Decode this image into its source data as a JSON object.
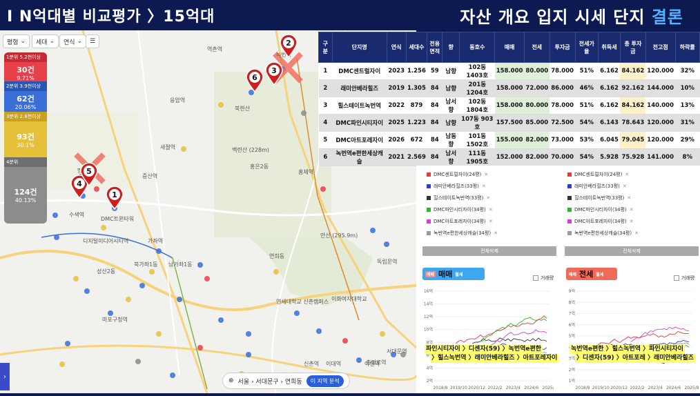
{
  "header": {
    "left": "I N억대별 비교평가 〉15억대",
    "right_main": "자산 개요 입지 시세 단지",
    "right_hl": "결론"
  },
  "map": {
    "controls": [
      "평형",
      "세대",
      "연식"
    ],
    "legend": [
      {
        "head": "1분위 5.2천이상",
        "value": "30건",
        "pct": "9.71%",
        "color": "#e8404a"
      },
      {
        "head": "2분위 3.9천이상",
        "value": "62건",
        "pct": "20.06%",
        "color": "#3a6fd8"
      },
      {
        "head": "3분위 2.8천이상",
        "value": "93건",
        "pct": "30.1%",
        "color": "#e7c03a"
      },
      {
        "head": "4분위",
        "value": "124건",
        "pct": "40.13%",
        "color": "#8c8c8c"
      }
    ],
    "labels": [
      "역촌역",
      "응암역",
      "새절역",
      "증산역",
      "수색역",
      "DMC트윈타워",
      "디지털미디어시티역",
      "가좌역",
      "홍제역",
      "홍은2동",
      "연희동",
      "신촌역",
      "이대역",
      "아현역",
      "마포구청역",
      "성산2동",
      "망원1동",
      "녹번역",
      "불광역",
      "북가좌1동",
      "남가좌1동",
      "연세대학교 신촌캠퍼스",
      "이화여자대학교",
      "안산 (295.9m)",
      "백련산 (228m)",
      "북한산",
      "독립문역",
      "충정로역",
      "서대문역"
    ],
    "location": "서울 › 서대문구 › 연희동",
    "analysis_btn": "이 지역 분석",
    "pins": [
      "1",
      "2",
      "3",
      "4",
      "5",
      "6"
    ]
  },
  "table": {
    "headers": [
      "구분",
      "단지명",
      "연식",
      "세대수",
      "전용면적",
      "향",
      "동호수",
      "매매",
      "전세",
      "투자금",
      "전세가율",
      "취득세",
      "총 투자금",
      "전고점",
      "하락률"
    ],
    "rows": [
      [
        "1",
        "DMC센트럴자이",
        "2023",
        "1.256",
        "59",
        "남향",
        "102동 1403호",
        "158.000",
        "80.000",
        "78.000",
        "51%",
        "6.162",
        "84.162",
        "120.000",
        "32%"
      ],
      [
        "2",
        "래미안베라힐즈",
        "2019",
        "1.305",
        "84",
        "남향",
        "201동 1204호",
        "158.000",
        "72.000",
        "86.000",
        "46%",
        "6.162",
        "92.162",
        "144.000",
        "10%"
      ],
      [
        "3",
        "힐스테이트녹번역",
        "2022",
        "879",
        "84",
        "남서향",
        "102동 1804호",
        "158.000",
        "80.000",
        "78.000",
        "51%",
        "6.162",
        "84.162",
        "140.000",
        "13%"
      ],
      [
        "4",
        "DMC파인시티자이",
        "2025",
        "1.223",
        "84",
        "남향",
        "107동 903호",
        "157.500",
        "85.000",
        "72.500",
        "54%",
        "6.143",
        "78.643",
        "120.000",
        "31%"
      ],
      [
        "5",
        "DMC아트포레자이",
        "2026",
        "672",
        "84",
        "남동향",
        "101동 1502호",
        "155.000",
        "82.000",
        "73.000",
        "53%",
        "6.045",
        "79.045",
        "120.000",
        "29%"
      ],
      [
        "6",
        "녹번역e편한세상캐슬",
        "2021",
        "2.569",
        "84",
        "남서향",
        "111동 1905호",
        "152.000",
        "82.000",
        "70.000",
        "54%",
        "5.928",
        "75.928",
        "141.000",
        "8%"
      ]
    ]
  },
  "complexes": [
    {
      "name": "DMC센트럴자이(24평)",
      "color": "#e23b3b"
    },
    {
      "name": "래미안베라힐즈(33평)",
      "color": "#2b3fd4"
    },
    {
      "name": "힐스테이트녹번역(33평)",
      "color": "#333333"
    },
    {
      "name": "DMC파인시티자이(34평)",
      "color": "#2fb52f"
    },
    {
      "name": "DMC아트포레자이(34평)",
      "color": "#d53fd5"
    },
    {
      "name": "녹번역e편한세상캐슬(34평)",
      "color": "#9a9a9a"
    }
  ],
  "delete_all": "전체삭제",
  "trade_chart": {
    "title": "매매",
    "tag_l": "매매",
    "tag_r": "월세",
    "volume_label": "거래량",
    "yticks": [
      "16억",
      "14억",
      "12억",
      "10억",
      "8억",
      "6억",
      "4억",
      "2억"
    ],
    "xticks": [
      "2018/8",
      "2019/10",
      "2020/12",
      "2022/2",
      "2023/4",
      "2024/6",
      "2025/8"
    ],
    "note1": "파인시티자이 〉디센자(59) 〉녹번역e편한",
    "note2": "〉힐스녹번역 〉래미안베라힐즈 〉아트포레자이"
  },
  "jeonse_chart": {
    "title": "전세",
    "tag_l": "매매",
    "tag_r": "월세",
    "volume_label": "거래량",
    "yticks": [
      "9억",
      "8억",
      "7억",
      "6억",
      "5억",
      "4억",
      "3억",
      "2억",
      "1억"
    ],
    "xticks": [
      "2018/8",
      "2019/10",
      "2020/12",
      "2022/2",
      "2023/4",
      "2024/6",
      "2025/8"
    ],
    "note1": "녹번역e편한 〉힐스녹번역 〉파인시티자이",
    "note2": "〉디센자(59) 〉아트포레 〉래미안베라힐즈"
  },
  "chart_data": [
    {
      "type": "line",
      "title": "매매",
      "ylabel": "",
      "ylim": [
        2,
        16
      ],
      "x": [
        "2018/8",
        "2019/10",
        "2020/12",
        "2022/2",
        "2023/4",
        "2024/6",
        "2025/8"
      ],
      "series": []
    },
    {
      "type": "line",
      "title": "전세",
      "ylabel": "",
      "ylim": [
        1,
        9
      ],
      "x": [
        "2018/8",
        "2019/10",
        "2020/12",
        "2022/2",
        "2023/4",
        "2024/6",
        "2025/8"
      ],
      "series": []
    }
  ]
}
